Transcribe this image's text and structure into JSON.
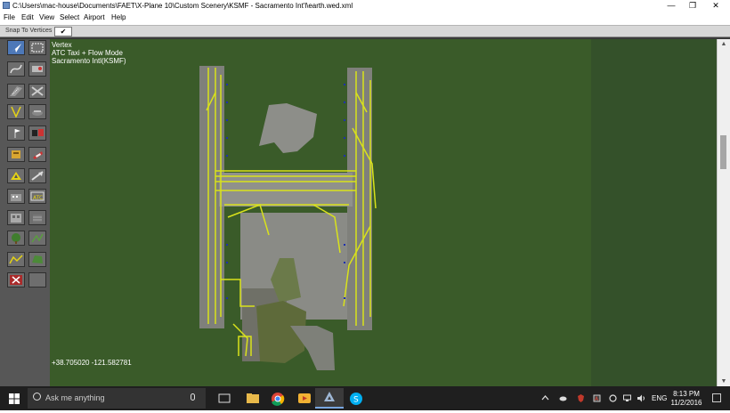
{
  "window": {
    "title": "C:\\Users\\mac-house\\Documents\\FAET\\X-Plane 10\\Custom Scenery\\KSMF - Sacramento Int'l\\earth.wed.xml",
    "minimize": "—",
    "restore": "❐",
    "close": "✕"
  },
  "menu": {
    "items": [
      "File",
      "Edit",
      "View",
      "Select",
      "Airport",
      "Help"
    ]
  },
  "tool_options": {
    "snap_label": "Snap To Vertices",
    "snap_value": "✔"
  },
  "map": {
    "hud": {
      "tool": "Vertex",
      "mode": "ATC Taxi + Flow Mode",
      "airport": "Sacramento Intl(KSMF)"
    },
    "coordinates": "+38.705020 -121.582781",
    "colors": {
      "grass": "#3a5b29",
      "pavement": "#8d8e89",
      "taxi_lines": "#d9e21b",
      "markers": "#1e2fb0"
    }
  },
  "toolbar": {
    "tools": [
      "vertex-tool",
      "marquee-tool",
      "bezier-tool",
      "taxiway-tool",
      "runway-tool",
      "helipad-tool",
      "taxiline-tool",
      "boundary-tool",
      "windsock-tool",
      "light-tool",
      "tower-tool",
      "sign-tool",
      "ramp-start-tool",
      "atc-flow-tool",
      "facade-tool",
      "object-tool",
      "forest-tool",
      "string-tool",
      "line-tool",
      "polygon-tool",
      "exclusion-tool",
      "blank-tool"
    ]
  },
  "taskbar": {
    "search_placeholder": "Ask me anything",
    "language": "ENG",
    "time": "8:13 PM",
    "date": "11/2/2016"
  }
}
